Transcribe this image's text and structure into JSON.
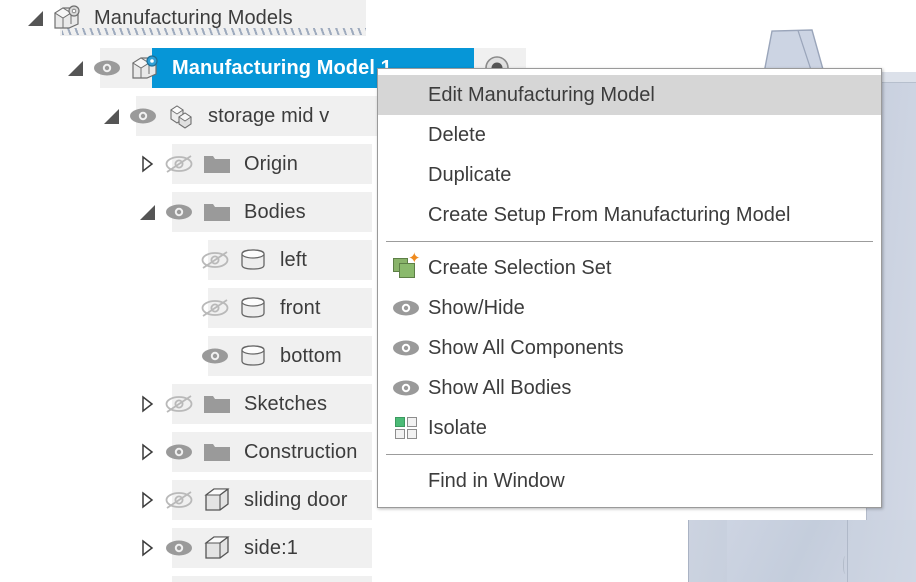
{
  "app": {
    "panel_name": "browser-tree",
    "accent_selection": "#0696d7",
    "row_bg": "#f0f0f0",
    "menu_highlight": "#d6d6d6",
    "text_color": "#3c3c3c"
  },
  "tree": {
    "root": {
      "label": "Manufacturing Models",
      "icon": "manufacturing-models-icon",
      "state": "expanded",
      "active_hatched": true
    },
    "items": [
      {
        "label": "Manufacturing Model 1",
        "icon": "manufacturing-model-icon",
        "expander": "expanded",
        "visibility": "visible",
        "selected": true,
        "has_radio": true,
        "indent": 1
      },
      {
        "label": "storage mid v",
        "icon": "component-icon",
        "expander": "expanded",
        "visibility": "visible",
        "selected": false,
        "indent": 2
      },
      {
        "label": "Origin",
        "icon": "folder-icon",
        "expander": "collapsed",
        "visibility": "hidden",
        "selected": false,
        "indent": 3
      },
      {
        "label": "Bodies",
        "icon": "folder-icon",
        "expander": "expanded",
        "visibility": "visible",
        "selected": false,
        "indent": 3
      },
      {
        "label": "left",
        "icon": "body-icon",
        "expander": "none",
        "visibility": "hidden",
        "selected": false,
        "indent": 4
      },
      {
        "label": "front",
        "icon": "body-icon",
        "expander": "none",
        "visibility": "hidden",
        "selected": false,
        "indent": 4
      },
      {
        "label": "bottom",
        "icon": "body-icon",
        "expander": "none",
        "visibility": "visible",
        "selected": false,
        "indent": 4
      },
      {
        "label": "Sketches",
        "icon": "folder-icon",
        "expander": "collapsed",
        "visibility": "hidden",
        "selected": false,
        "indent": 3
      },
      {
        "label": "Construction",
        "icon": "folder-icon",
        "expander": "collapsed",
        "visibility": "visible",
        "selected": false,
        "indent": 3
      },
      {
        "label": "sliding door",
        "icon": "body-cube-icon",
        "expander": "collapsed",
        "visibility": "hidden",
        "selected": false,
        "indent": 3
      },
      {
        "label": "side:1",
        "icon": "body-cube-icon",
        "expander": "collapsed",
        "visibility": "visible",
        "selected": false,
        "indent": 3
      }
    ]
  },
  "context_menu": {
    "groups": [
      {
        "items": [
          {
            "label": "Edit Manufacturing Model",
            "icon": null,
            "highlighted": true
          },
          {
            "label": "Delete",
            "icon": null,
            "highlighted": false
          },
          {
            "label": "Duplicate",
            "icon": null,
            "highlighted": false
          },
          {
            "label": "Create Setup From Manufacturing Model",
            "icon": null,
            "highlighted": false
          }
        ]
      },
      {
        "items": [
          {
            "label": "Create Selection Set",
            "icon": "create-selection-set-icon",
            "highlighted": false
          },
          {
            "label": "Show/Hide",
            "icon": "eye-icon",
            "highlighted": false
          },
          {
            "label": "Show All Components",
            "icon": "eye-icon",
            "highlighted": false
          },
          {
            "label": "Show All Bodies",
            "icon": "eye-icon",
            "highlighted": false
          },
          {
            "label": "Isolate",
            "icon": "isolate-grid-icon",
            "highlighted": false
          }
        ]
      },
      {
        "items": [
          {
            "label": "Find in Window",
            "icon": null,
            "highlighted": false
          }
        ]
      }
    ]
  }
}
